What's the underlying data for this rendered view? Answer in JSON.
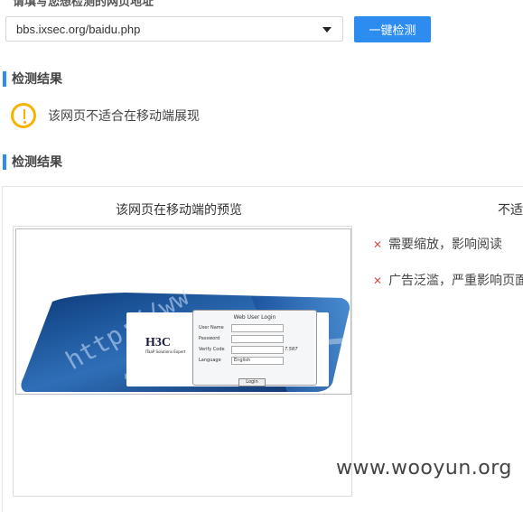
{
  "form": {
    "label": "请填写您想检测的网页地址",
    "url_value": "bbs.ixsec.org/baidu.php",
    "check_button": "一键检测"
  },
  "sections": [
    {
      "title": "检测结果"
    },
    {
      "title": "检测结果"
    }
  ],
  "warning": {
    "icon": "warning-circle-icon",
    "text": "该网页不适合在移动端展现",
    "color": "#f5b400"
  },
  "preview": {
    "title": "该网页在移动端的预览",
    "login": {
      "brand": "H3C",
      "brand_sub": "ITaaP Solutions Expert",
      "title": "Web User Login",
      "username_label": "User Name",
      "password_label": "Password",
      "verify_label": "Verify Code",
      "verify_code": "7.5R7",
      "language_label": "Language",
      "language_value": "English",
      "login_button": "Login",
      "banner_text": "http://ww"
    }
  },
  "issues": {
    "title": "不适",
    "items": [
      {
        "icon": "x-icon",
        "text": "需要缩放，影响阅读"
      },
      {
        "icon": "x-icon",
        "text": "广告泛滥，严重影响页面"
      }
    ]
  },
  "watermark": "www.wooyun.org",
  "colors": {
    "accent": "#2d8cf0",
    "warning": "#f5b400",
    "error": "#e05050"
  }
}
